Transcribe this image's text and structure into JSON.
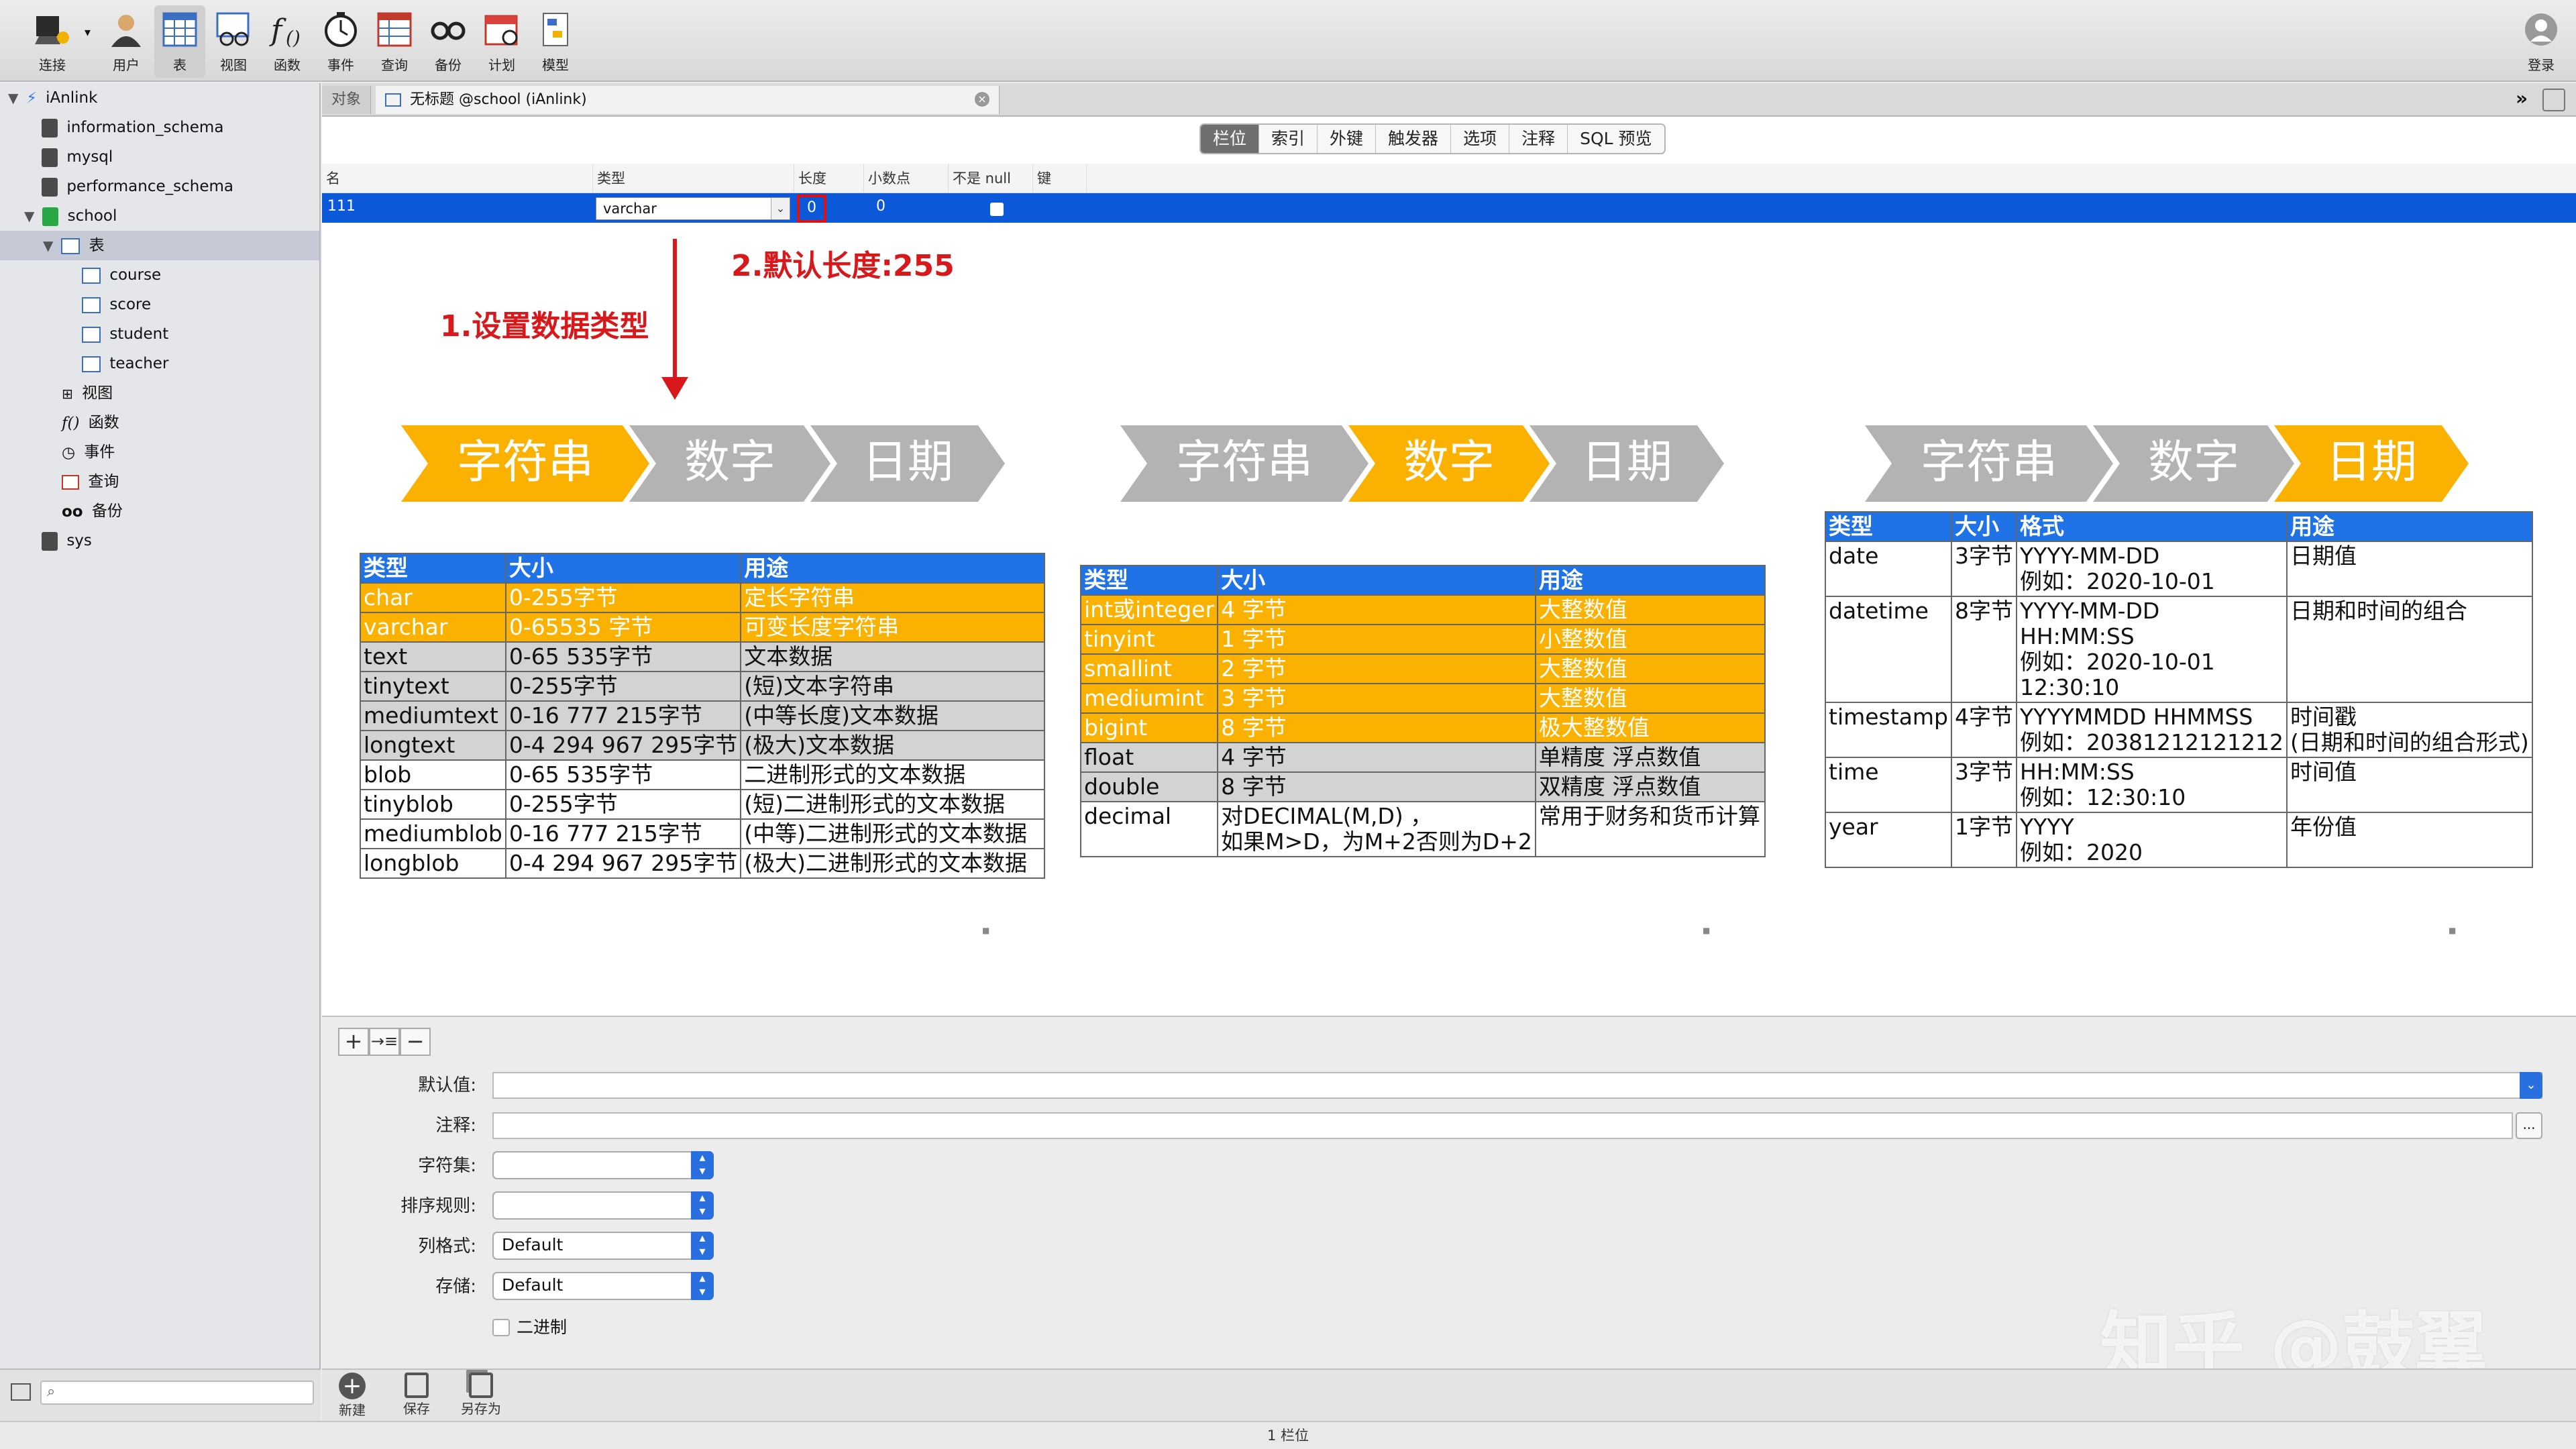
{
  "toolbar": {
    "items": [
      {
        "label": "连接",
        "icon": "connect-icon"
      },
      {
        "label": "用户",
        "icon": "user-icon"
      },
      {
        "label": "表",
        "icon": "table-icon"
      },
      {
        "label": "视图",
        "icon": "view-icon"
      },
      {
        "label": "函数",
        "icon": "function-icon"
      },
      {
        "label": "事件",
        "icon": "event-icon"
      },
      {
        "label": "查询",
        "icon": "query-icon"
      },
      {
        "label": "备份",
        "icon": "backup-icon"
      },
      {
        "label": "计划",
        "icon": "schedule-icon"
      },
      {
        "label": "模型",
        "icon": "model-icon"
      }
    ],
    "login_label": "登录"
  },
  "sidebar": {
    "connection": "iAnlink",
    "databases": [
      "information_schema",
      "mysql",
      "performance_schema",
      "school",
      "sys"
    ],
    "tables_label": "表",
    "tables": [
      "course",
      "score",
      "student",
      "teacher"
    ],
    "groups": [
      "视图",
      "函数",
      "事件",
      "查询",
      "备份"
    ]
  },
  "tabs": {
    "objects": "对象",
    "document": "无标题 @school (iAnlink)"
  },
  "designer": {
    "segments": [
      "栏位",
      "索引",
      "外键",
      "触发器",
      "选项",
      "注释",
      "SQL 预览"
    ],
    "columns": [
      "名",
      "类型",
      "长度",
      "小数点",
      "不是 null",
      "键"
    ],
    "row": {
      "name": "111",
      "type": "varchar",
      "length": "0",
      "decimals": "0"
    }
  },
  "annotations": {
    "set_type": "1.设置数据类型",
    "default_length": "2.默认长度:255"
  },
  "chevrons": {
    "labels": [
      "字符串",
      "数字",
      "日期"
    ],
    "active_color": "#fbb100",
    "inactive_color": "#b3b3b3"
  },
  "string_table": {
    "headers": [
      "类型",
      "大小",
      "用途"
    ],
    "rows": [
      [
        "char",
        "0-255字节",
        "定长字符串"
      ],
      [
        "varchar",
        "0-65535 字节",
        "可变长度字符串"
      ],
      [
        "text",
        "0-65 535字节",
        "文本数据"
      ],
      [
        "tinytext",
        "0-255字节",
        "(短)文本字符串"
      ],
      [
        "mediumtext",
        "0-16 777 215字节",
        "(中等长度)文本数据"
      ],
      [
        "longtext",
        "0-4 294 967 295字节",
        "(极大)文本数据"
      ],
      [
        "blob",
        "0-65 535字节",
        "二进制形式的文本数据"
      ],
      [
        "tinyblob",
        "0-255字节",
        "(短)二进制形式的文本数据"
      ],
      [
        "mediumblob",
        "0-16 777 215字节",
        "(中等)二进制形式的文本数据"
      ],
      [
        "longblob",
        "0-4 294 967 295字节",
        "(极大)二进制形式的文本数据"
      ]
    ]
  },
  "number_table": {
    "headers": [
      "类型",
      "大小",
      "用途"
    ],
    "rows": [
      [
        "int或integer",
        "4 字节",
        "大整数值"
      ],
      [
        "tinyint",
        "1 字节",
        "小整数值"
      ],
      [
        "smallint",
        "2 字节",
        "大整数值"
      ],
      [
        "mediumint",
        "3 字节",
        "大整数值"
      ],
      [
        "bigint",
        "8 字节",
        "极大整数值"
      ],
      [
        "float",
        "4 字节",
        "单精度 浮点数值"
      ],
      [
        "double",
        "8 字节",
        "双精度 浮点数值"
      ],
      [
        "decimal",
        "对DECIMAL(M,D) ，\n如果M>D，为M+2否则为D+2",
        "常用于财务和货币计算"
      ]
    ]
  },
  "date_table": {
    "headers": [
      "类型",
      "大小",
      "格式",
      "用途"
    ],
    "rows": [
      [
        "date",
        "3字节",
        "YYYY-MM-DD\n例如：2020-10-01",
        "日期值"
      ],
      [
        "datetime",
        "8字节",
        "YYYY-MM-DD\nHH:MM:SS\n例如：2020-10-01\n12:30:10",
        "日期和时间的组合"
      ],
      [
        "timestamp",
        "4字节",
        "YYYYMMDD HHMMSS\n例如：20381212121212",
        "时间戳\n(日期和时间的组合形式)"
      ],
      [
        "time",
        "3字节",
        "HH:MM:SS\n例如：12:30:10",
        "时间值"
      ],
      [
        "year",
        "1字节",
        "YYYY\n例如：2020",
        "年份值"
      ]
    ]
  },
  "properties": {
    "default_label": "默认值:",
    "comment_label": "注释:",
    "charset_label": "字符集:",
    "collation_label": "排序规则:",
    "column_format_label": "列格式:",
    "column_format_value": "Default",
    "storage_label": "存储:",
    "storage_value": "Default",
    "binary_label": "二进制",
    "more_button": "..."
  },
  "bottom_actions": [
    "新建",
    "保存",
    "另存为"
  ],
  "status": "1 栏位",
  "watermark": "知乎 @鼓翼"
}
